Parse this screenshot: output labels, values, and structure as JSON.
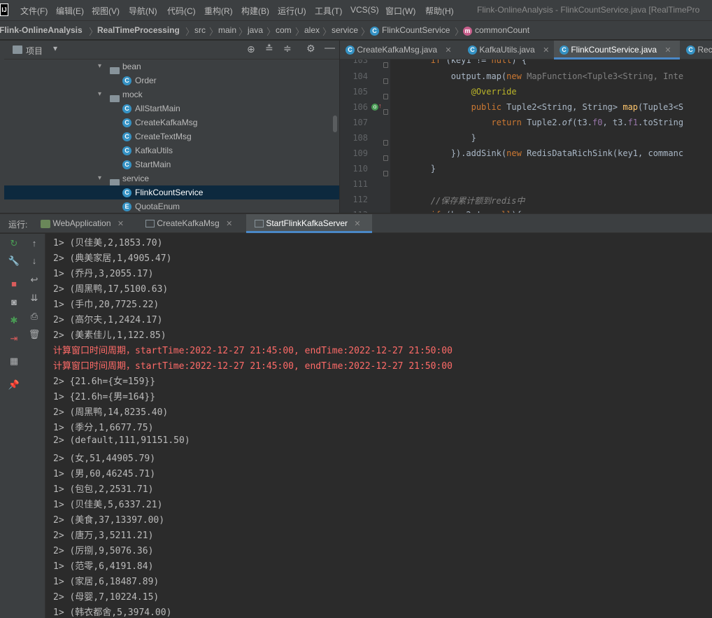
{
  "app": {
    "logo": "IJ",
    "window_title": "Flink-OnlineAnalysis - FlinkCountService.java [RealTimePro"
  },
  "menu": [
    "文件(F)",
    "编辑(E)",
    "视图(V)",
    "导航(N)",
    "代码(C)",
    "重构(R)",
    "构建(B)",
    "运行(U)",
    "工具(T)",
    "VCS(S)",
    "窗口(W)",
    "帮助(H)"
  ],
  "breadcrumb": [
    "Flink-OnlineAnalysis",
    "RealTimeProcessing",
    "src",
    "main",
    "java",
    "com",
    "alex",
    "service",
    "FlinkCountService",
    "commonCount"
  ],
  "project": {
    "title": "项目",
    "tree": [
      {
        "label": "bean",
        "kind": "folder"
      },
      {
        "label": "Order",
        "kind": "class"
      },
      {
        "label": "mock",
        "kind": "folder"
      },
      {
        "label": "AllStartMain",
        "kind": "class"
      },
      {
        "label": "CreateKafkaMsg",
        "kind": "class"
      },
      {
        "label": "CreateTextMsg",
        "kind": "class"
      },
      {
        "label": "KafkaUtils",
        "kind": "class"
      },
      {
        "label": "StartMain",
        "kind": "class"
      },
      {
        "label": "service",
        "kind": "folder"
      },
      {
        "label": "FlinkCountService",
        "kind": "class",
        "selected": true
      },
      {
        "label": "QuotaEnum",
        "kind": "enum"
      }
    ]
  },
  "editor": {
    "tabs": [
      "CreateKafkaMsg.java",
      "KafkaUtils.java",
      "FlinkCountService.java",
      "Rec"
    ],
    "active_tab": "FlinkCountService.java",
    "line_numbers": [
      "103",
      "104",
      "105",
      "106",
      "107",
      "108",
      "109",
      "110",
      "111",
      "112",
      "113"
    ]
  },
  "run": {
    "label": "运行:",
    "tabs": [
      "WebApplication",
      "CreateKafkaMsg",
      "StartFlinkKafkaServer"
    ],
    "active_tab": "StartFlinkKafkaServer",
    "output": [
      "1> (贝佳美,2,1853.70)",
      "2> (典美家居,1,4905.47)",
      "1> (乔丹,3,2055.17)",
      "2> (周黑鸭,17,5100.63)",
      "1> (手巾,20,7725.22)",
      "2> (高尔夫,1,2424.17)",
      "2> (美素佳儿,1,122.85)",
      "计算窗口时间周期，startTime:2022-12-27 21:45:00, endTime:2022-12-27 21:50:00",
      "计算窗口时间周期，startTime:2022-12-27 21:45:00, endTime:2022-12-27 21:50:00",
      "2> {21.6h={女=159}}",
      "1> {21.6h={男=164}}",
      "2> (周黑鸭,14,8235.40)",
      "1> (季分,1,6677.75)",
      "2> (default,111,91151.50)",
      "2> (女,51,44905.79)",
      "1> (男,60,46245.71)",
      "1> (包包,2,2531.71)",
      "1> (贝佳美,5,6337.21)",
      "2> (美食,37,13397.00)",
      "2> (唐万,3,5211.21)",
      "2> (厉捌,9,5076.36)",
      "1> (范零,6,4191.84)",
      "1> (家居,6,18487.89)",
      "2> (母婴,7,10224.15)",
      "1> (韩衣都舍,5,3974.00)"
    ],
    "error_lines": [
      7,
      8
    ]
  },
  "colors": {
    "accent": "#4a88c7",
    "error": "#ff6b68",
    "keyword": "#cc7832",
    "annotation": "#bbb529",
    "method": "#ffc66d"
  }
}
